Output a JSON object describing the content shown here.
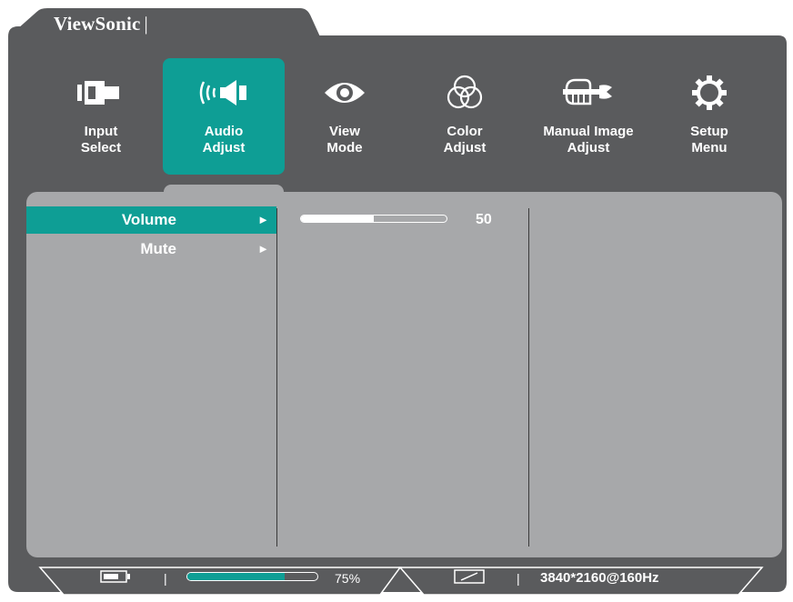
{
  "brand": {
    "name": "ViewSonic",
    "separator": "|"
  },
  "tabs": [
    {
      "label1": "Input",
      "label2": "Select",
      "icon": "input-select-icon",
      "active": false
    },
    {
      "label1": "Audio",
      "label2": "Adjust",
      "icon": "audio-icon",
      "active": true
    },
    {
      "label1": "View",
      "label2": "Mode",
      "icon": "eye-icon",
      "active": false
    },
    {
      "label1": "Color",
      "label2": "Adjust",
      "icon": "color-circles-icon",
      "active": false
    },
    {
      "label1": "Manual Image",
      "label2": "Adjust",
      "icon": "hand-wrench-icon",
      "active": false
    },
    {
      "label1": "Setup",
      "label2": "Menu",
      "icon": "gear-icon",
      "active": false
    }
  ],
  "submenu": [
    {
      "label": "Volume",
      "arrow": "►",
      "active": true
    },
    {
      "label": "Mute",
      "arrow": "►",
      "active": false
    }
  ],
  "volume": {
    "value": "50",
    "fraction": 0.5
  },
  "status": {
    "separator": "|",
    "progress_label": "75%",
    "progress_fraction": 0.75,
    "resolution": "3840*2160@160Hz"
  },
  "colors": {
    "frame": "#5a5b5d",
    "accent": "#0e9e95",
    "panel": "#a7a8aa"
  }
}
